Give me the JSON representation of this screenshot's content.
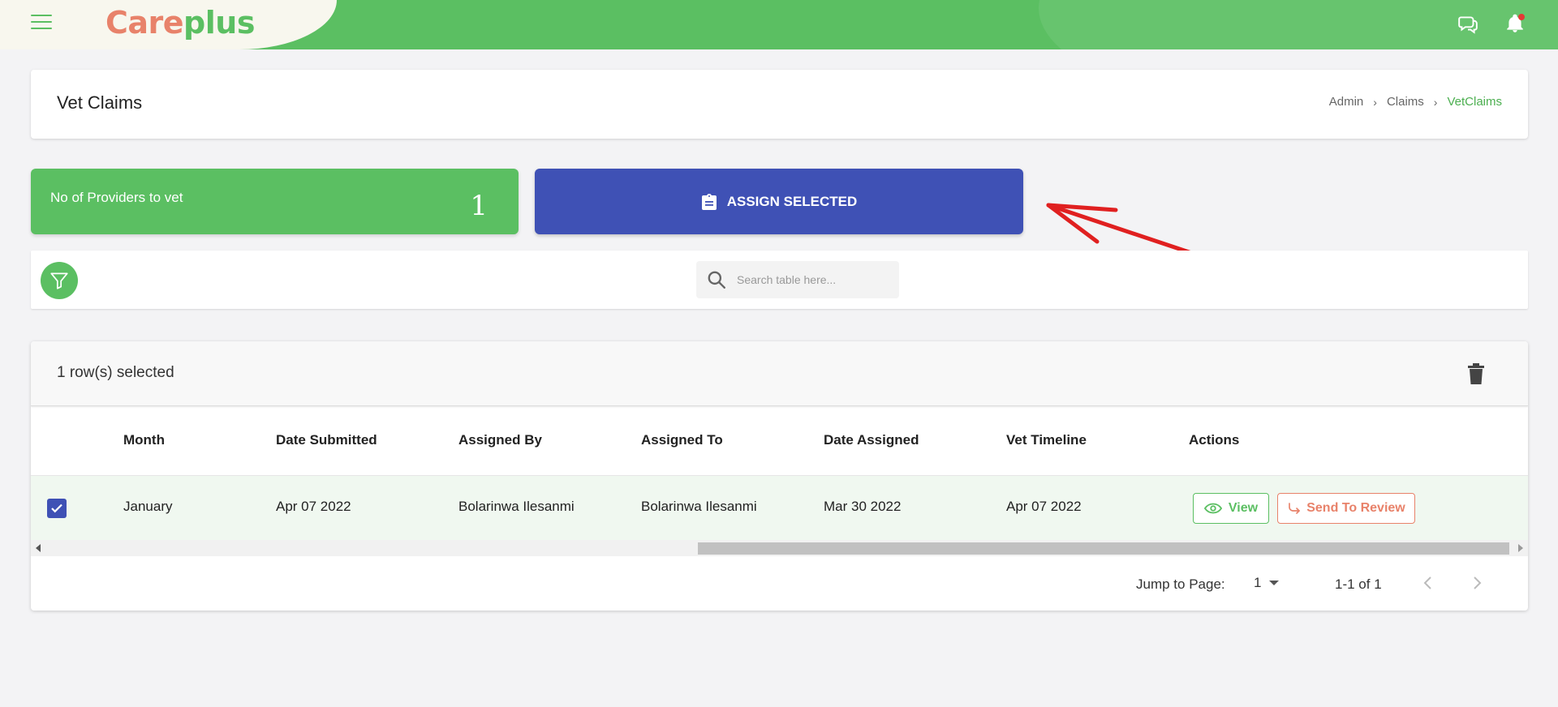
{
  "app": {
    "logo_part1": "Care",
    "logo_part2": "plus",
    "brand_color": "#5bbf62",
    "accent_orange": "#e8826a",
    "primary_blue": "#3f51b5"
  },
  "header": {
    "title": "Vet Claims",
    "breadcrumb": [
      "Admin",
      "Claims",
      "VetClaims"
    ]
  },
  "stats": {
    "label": "No of Providers to vet",
    "value": "1"
  },
  "assign": {
    "label": "ASSIGN SELECTED"
  },
  "search": {
    "placeholder": "Search table here..."
  },
  "table": {
    "selection_text": "1 row(s) selected",
    "columns": [
      "Month",
      "Date Submitted",
      "Assigned By",
      "Assigned To",
      "Date Assigned",
      "Vet Timeline",
      "Actions"
    ],
    "rows": [
      {
        "selected": true,
        "month": "January",
        "date_submitted": "Apr 07 2022",
        "assigned_by": "Bolarinwa Ilesanmi",
        "assigned_to": "Bolarinwa Ilesanmi",
        "date_assigned": "Mar 30 2022",
        "vet_timeline": "Apr 07 2022",
        "view_label": "View",
        "review_label": "Send To Review"
      }
    ]
  },
  "pagination": {
    "jump_label": "Jump to Page:",
    "current_page": "1",
    "range_text": "1-1 of 1"
  },
  "icons": {
    "menu": "menu-icon",
    "chat": "chat-icon",
    "bell": "bell-icon",
    "clipboard": "clipboard-icon",
    "filter": "filter-icon",
    "search": "search-icon",
    "trash": "trash-icon",
    "eye": "eye-icon",
    "redo": "redo-arrow-icon",
    "chevron_left": "chevron-left-icon",
    "chevron_right": "chevron-right-icon"
  }
}
